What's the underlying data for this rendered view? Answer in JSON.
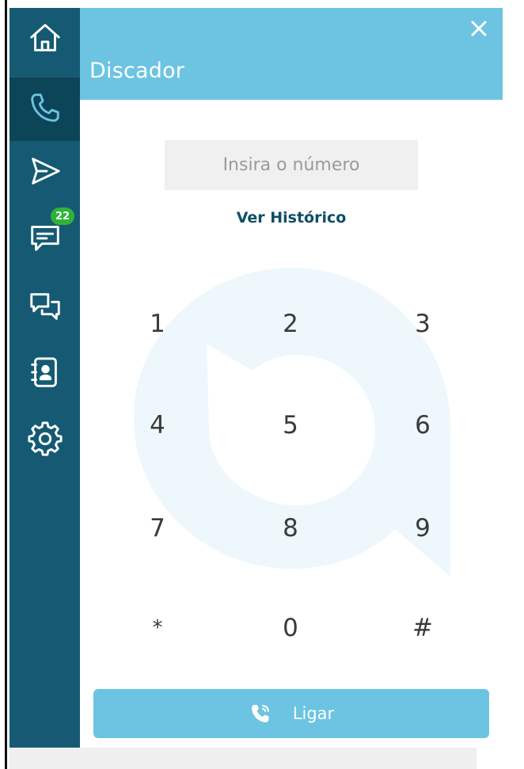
{
  "panel": {
    "title": "Discador",
    "close_icon": "close-icon"
  },
  "sidebar": {
    "items": [
      {
        "name": "home",
        "icon": "home-icon",
        "active": false
      },
      {
        "name": "phone",
        "icon": "phone-icon",
        "active": true
      },
      {
        "name": "send",
        "icon": "send-icon",
        "active": false
      },
      {
        "name": "messages",
        "icon": "chat-icon",
        "active": false,
        "badge": "22"
      },
      {
        "name": "conversations",
        "icon": "conversations-icon",
        "active": false
      },
      {
        "name": "contacts",
        "icon": "contacts-icon",
        "active": false
      },
      {
        "name": "settings",
        "icon": "gear-icon",
        "active": false
      }
    ]
  },
  "dialer": {
    "placeholder": "Insira o número",
    "history_label": "Ver Histórico",
    "keys": [
      "1",
      "2",
      "3",
      "4",
      "5",
      "6",
      "7",
      "8",
      "9",
      "*",
      "0",
      "#"
    ],
    "call_label": "Ligar"
  },
  "colors": {
    "sidebar": "#155a72",
    "sidebar_active": "#0d4558",
    "header": "#6cc4e2",
    "badge": "#2db33a",
    "link": "#0d4e66"
  }
}
